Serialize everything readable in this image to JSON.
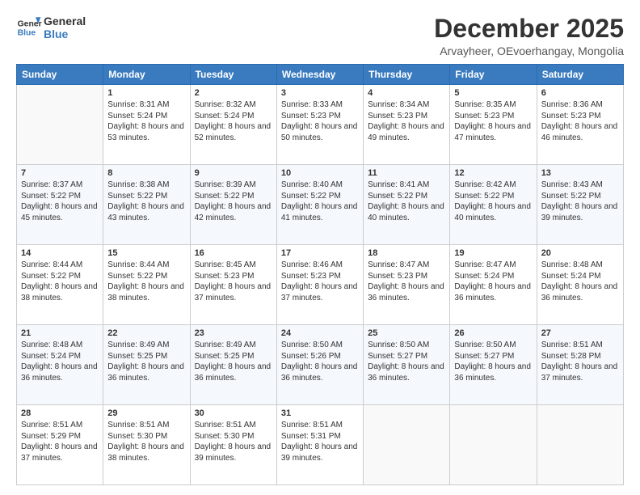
{
  "logo": {
    "line1": "General",
    "line2": "Blue"
  },
  "title": "December 2025",
  "subtitle": "Arvayheer, OEvoerhangay, Mongolia",
  "header_days": [
    "Sunday",
    "Monday",
    "Tuesday",
    "Wednesday",
    "Thursday",
    "Friday",
    "Saturday"
  ],
  "weeks": [
    [
      {
        "day": "",
        "sunrise": "",
        "sunset": "",
        "daylight": ""
      },
      {
        "day": "1",
        "sunrise": "Sunrise: 8:31 AM",
        "sunset": "Sunset: 5:24 PM",
        "daylight": "Daylight: 8 hours and 53 minutes."
      },
      {
        "day": "2",
        "sunrise": "Sunrise: 8:32 AM",
        "sunset": "Sunset: 5:24 PM",
        "daylight": "Daylight: 8 hours and 52 minutes."
      },
      {
        "day": "3",
        "sunrise": "Sunrise: 8:33 AM",
        "sunset": "Sunset: 5:23 PM",
        "daylight": "Daylight: 8 hours and 50 minutes."
      },
      {
        "day": "4",
        "sunrise": "Sunrise: 8:34 AM",
        "sunset": "Sunset: 5:23 PM",
        "daylight": "Daylight: 8 hours and 49 minutes."
      },
      {
        "day": "5",
        "sunrise": "Sunrise: 8:35 AM",
        "sunset": "Sunset: 5:23 PM",
        "daylight": "Daylight: 8 hours and 47 minutes."
      },
      {
        "day": "6",
        "sunrise": "Sunrise: 8:36 AM",
        "sunset": "Sunset: 5:23 PM",
        "daylight": "Daylight: 8 hours and 46 minutes."
      }
    ],
    [
      {
        "day": "7",
        "sunrise": "Sunrise: 8:37 AM",
        "sunset": "Sunset: 5:22 PM",
        "daylight": "Daylight: 8 hours and 45 minutes."
      },
      {
        "day": "8",
        "sunrise": "Sunrise: 8:38 AM",
        "sunset": "Sunset: 5:22 PM",
        "daylight": "Daylight: 8 hours and 43 minutes."
      },
      {
        "day": "9",
        "sunrise": "Sunrise: 8:39 AM",
        "sunset": "Sunset: 5:22 PM",
        "daylight": "Daylight: 8 hours and 42 minutes."
      },
      {
        "day": "10",
        "sunrise": "Sunrise: 8:40 AM",
        "sunset": "Sunset: 5:22 PM",
        "daylight": "Daylight: 8 hours and 41 minutes."
      },
      {
        "day": "11",
        "sunrise": "Sunrise: 8:41 AM",
        "sunset": "Sunset: 5:22 PM",
        "daylight": "Daylight: 8 hours and 40 minutes."
      },
      {
        "day": "12",
        "sunrise": "Sunrise: 8:42 AM",
        "sunset": "Sunset: 5:22 PM",
        "daylight": "Daylight: 8 hours and 40 minutes."
      },
      {
        "day": "13",
        "sunrise": "Sunrise: 8:43 AM",
        "sunset": "Sunset: 5:22 PM",
        "daylight": "Daylight: 8 hours and 39 minutes."
      }
    ],
    [
      {
        "day": "14",
        "sunrise": "Sunrise: 8:44 AM",
        "sunset": "Sunset: 5:22 PM",
        "daylight": "Daylight: 8 hours and 38 minutes."
      },
      {
        "day": "15",
        "sunrise": "Sunrise: 8:44 AM",
        "sunset": "Sunset: 5:22 PM",
        "daylight": "Daylight: 8 hours and 38 minutes."
      },
      {
        "day": "16",
        "sunrise": "Sunrise: 8:45 AM",
        "sunset": "Sunset: 5:23 PM",
        "daylight": "Daylight: 8 hours and 37 minutes."
      },
      {
        "day": "17",
        "sunrise": "Sunrise: 8:46 AM",
        "sunset": "Sunset: 5:23 PM",
        "daylight": "Daylight: 8 hours and 37 minutes."
      },
      {
        "day": "18",
        "sunrise": "Sunrise: 8:47 AM",
        "sunset": "Sunset: 5:23 PM",
        "daylight": "Daylight: 8 hours and 36 minutes."
      },
      {
        "day": "19",
        "sunrise": "Sunrise: 8:47 AM",
        "sunset": "Sunset: 5:24 PM",
        "daylight": "Daylight: 8 hours and 36 minutes."
      },
      {
        "day": "20",
        "sunrise": "Sunrise: 8:48 AM",
        "sunset": "Sunset: 5:24 PM",
        "daylight": "Daylight: 8 hours and 36 minutes."
      }
    ],
    [
      {
        "day": "21",
        "sunrise": "Sunrise: 8:48 AM",
        "sunset": "Sunset: 5:24 PM",
        "daylight": "Daylight: 8 hours and 36 minutes."
      },
      {
        "day": "22",
        "sunrise": "Sunrise: 8:49 AM",
        "sunset": "Sunset: 5:25 PM",
        "daylight": "Daylight: 8 hours and 36 minutes."
      },
      {
        "day": "23",
        "sunrise": "Sunrise: 8:49 AM",
        "sunset": "Sunset: 5:25 PM",
        "daylight": "Daylight: 8 hours and 36 minutes."
      },
      {
        "day": "24",
        "sunrise": "Sunrise: 8:50 AM",
        "sunset": "Sunset: 5:26 PM",
        "daylight": "Daylight: 8 hours and 36 minutes."
      },
      {
        "day": "25",
        "sunrise": "Sunrise: 8:50 AM",
        "sunset": "Sunset: 5:27 PM",
        "daylight": "Daylight: 8 hours and 36 minutes."
      },
      {
        "day": "26",
        "sunrise": "Sunrise: 8:50 AM",
        "sunset": "Sunset: 5:27 PM",
        "daylight": "Daylight: 8 hours and 36 minutes."
      },
      {
        "day": "27",
        "sunrise": "Sunrise: 8:51 AM",
        "sunset": "Sunset: 5:28 PM",
        "daylight": "Daylight: 8 hours and 37 minutes."
      }
    ],
    [
      {
        "day": "28",
        "sunrise": "Sunrise: 8:51 AM",
        "sunset": "Sunset: 5:29 PM",
        "daylight": "Daylight: 8 hours and 37 minutes."
      },
      {
        "day": "29",
        "sunrise": "Sunrise: 8:51 AM",
        "sunset": "Sunset: 5:30 PM",
        "daylight": "Daylight: 8 hours and 38 minutes."
      },
      {
        "day": "30",
        "sunrise": "Sunrise: 8:51 AM",
        "sunset": "Sunset: 5:30 PM",
        "daylight": "Daylight: 8 hours and 39 minutes."
      },
      {
        "day": "31",
        "sunrise": "Sunrise: 8:51 AM",
        "sunset": "Sunset: 5:31 PM",
        "daylight": "Daylight: 8 hours and 39 minutes."
      },
      {
        "day": "",
        "sunrise": "",
        "sunset": "",
        "daylight": ""
      },
      {
        "day": "",
        "sunrise": "",
        "sunset": "",
        "daylight": ""
      },
      {
        "day": "",
        "sunrise": "",
        "sunset": "",
        "daylight": ""
      }
    ]
  ]
}
